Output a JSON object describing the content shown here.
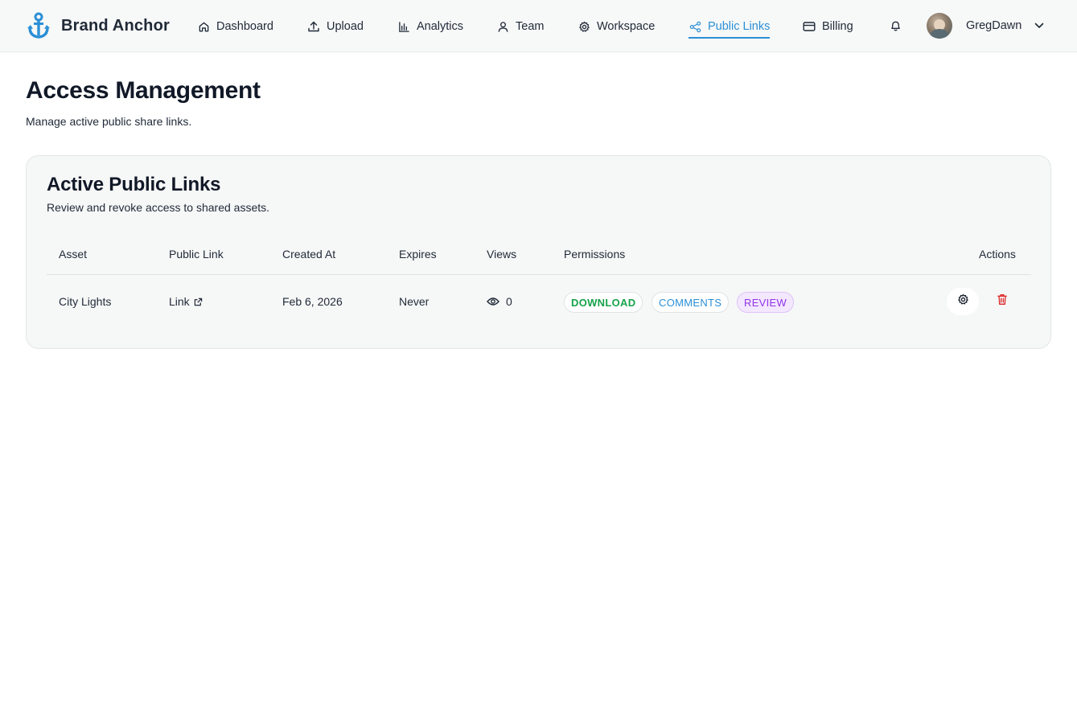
{
  "header": {
    "brand_name": "Brand Anchor",
    "brand_icon": "anchor-icon",
    "accent_color": "#2b8fd6",
    "nav": [
      {
        "label": "Dashboard",
        "icon": "home-icon"
      },
      {
        "label": "Upload",
        "icon": "upload-icon"
      },
      {
        "label": "Analytics",
        "icon": "bar-chart-icon"
      },
      {
        "label": "Team",
        "icon": "user-icon"
      },
      {
        "label": "Workspace",
        "icon": "gear-icon"
      },
      {
        "label": "Public Links",
        "icon": "share-icon",
        "active": true
      },
      {
        "label": "Billing",
        "icon": "credit-card-icon"
      }
    ],
    "notifications_icon": "bell-icon",
    "user_name": "GregDawn"
  },
  "page": {
    "title": "Access Management",
    "subtitle": "Manage active public share links."
  },
  "card": {
    "title": "Active Public Links",
    "subtitle": "Review and revoke access to shared assets.",
    "columns": [
      "Asset",
      "Public Link",
      "Created At",
      "Expires",
      "Views",
      "Permissions",
      "Actions"
    ],
    "rows": [
      {
        "asset": "City Lights",
        "public_link": "Link",
        "created_at": "Feb 6, 2026",
        "expires": "Never",
        "views": "0",
        "permissions": [
          "DOWNLOAD",
          "COMMENTS",
          "REVIEW"
        ]
      }
    ]
  },
  "colors": {
    "download": "#16a34a",
    "comments": "#2b8fd6",
    "review": "#9333ea",
    "delete": "#dc2626"
  }
}
